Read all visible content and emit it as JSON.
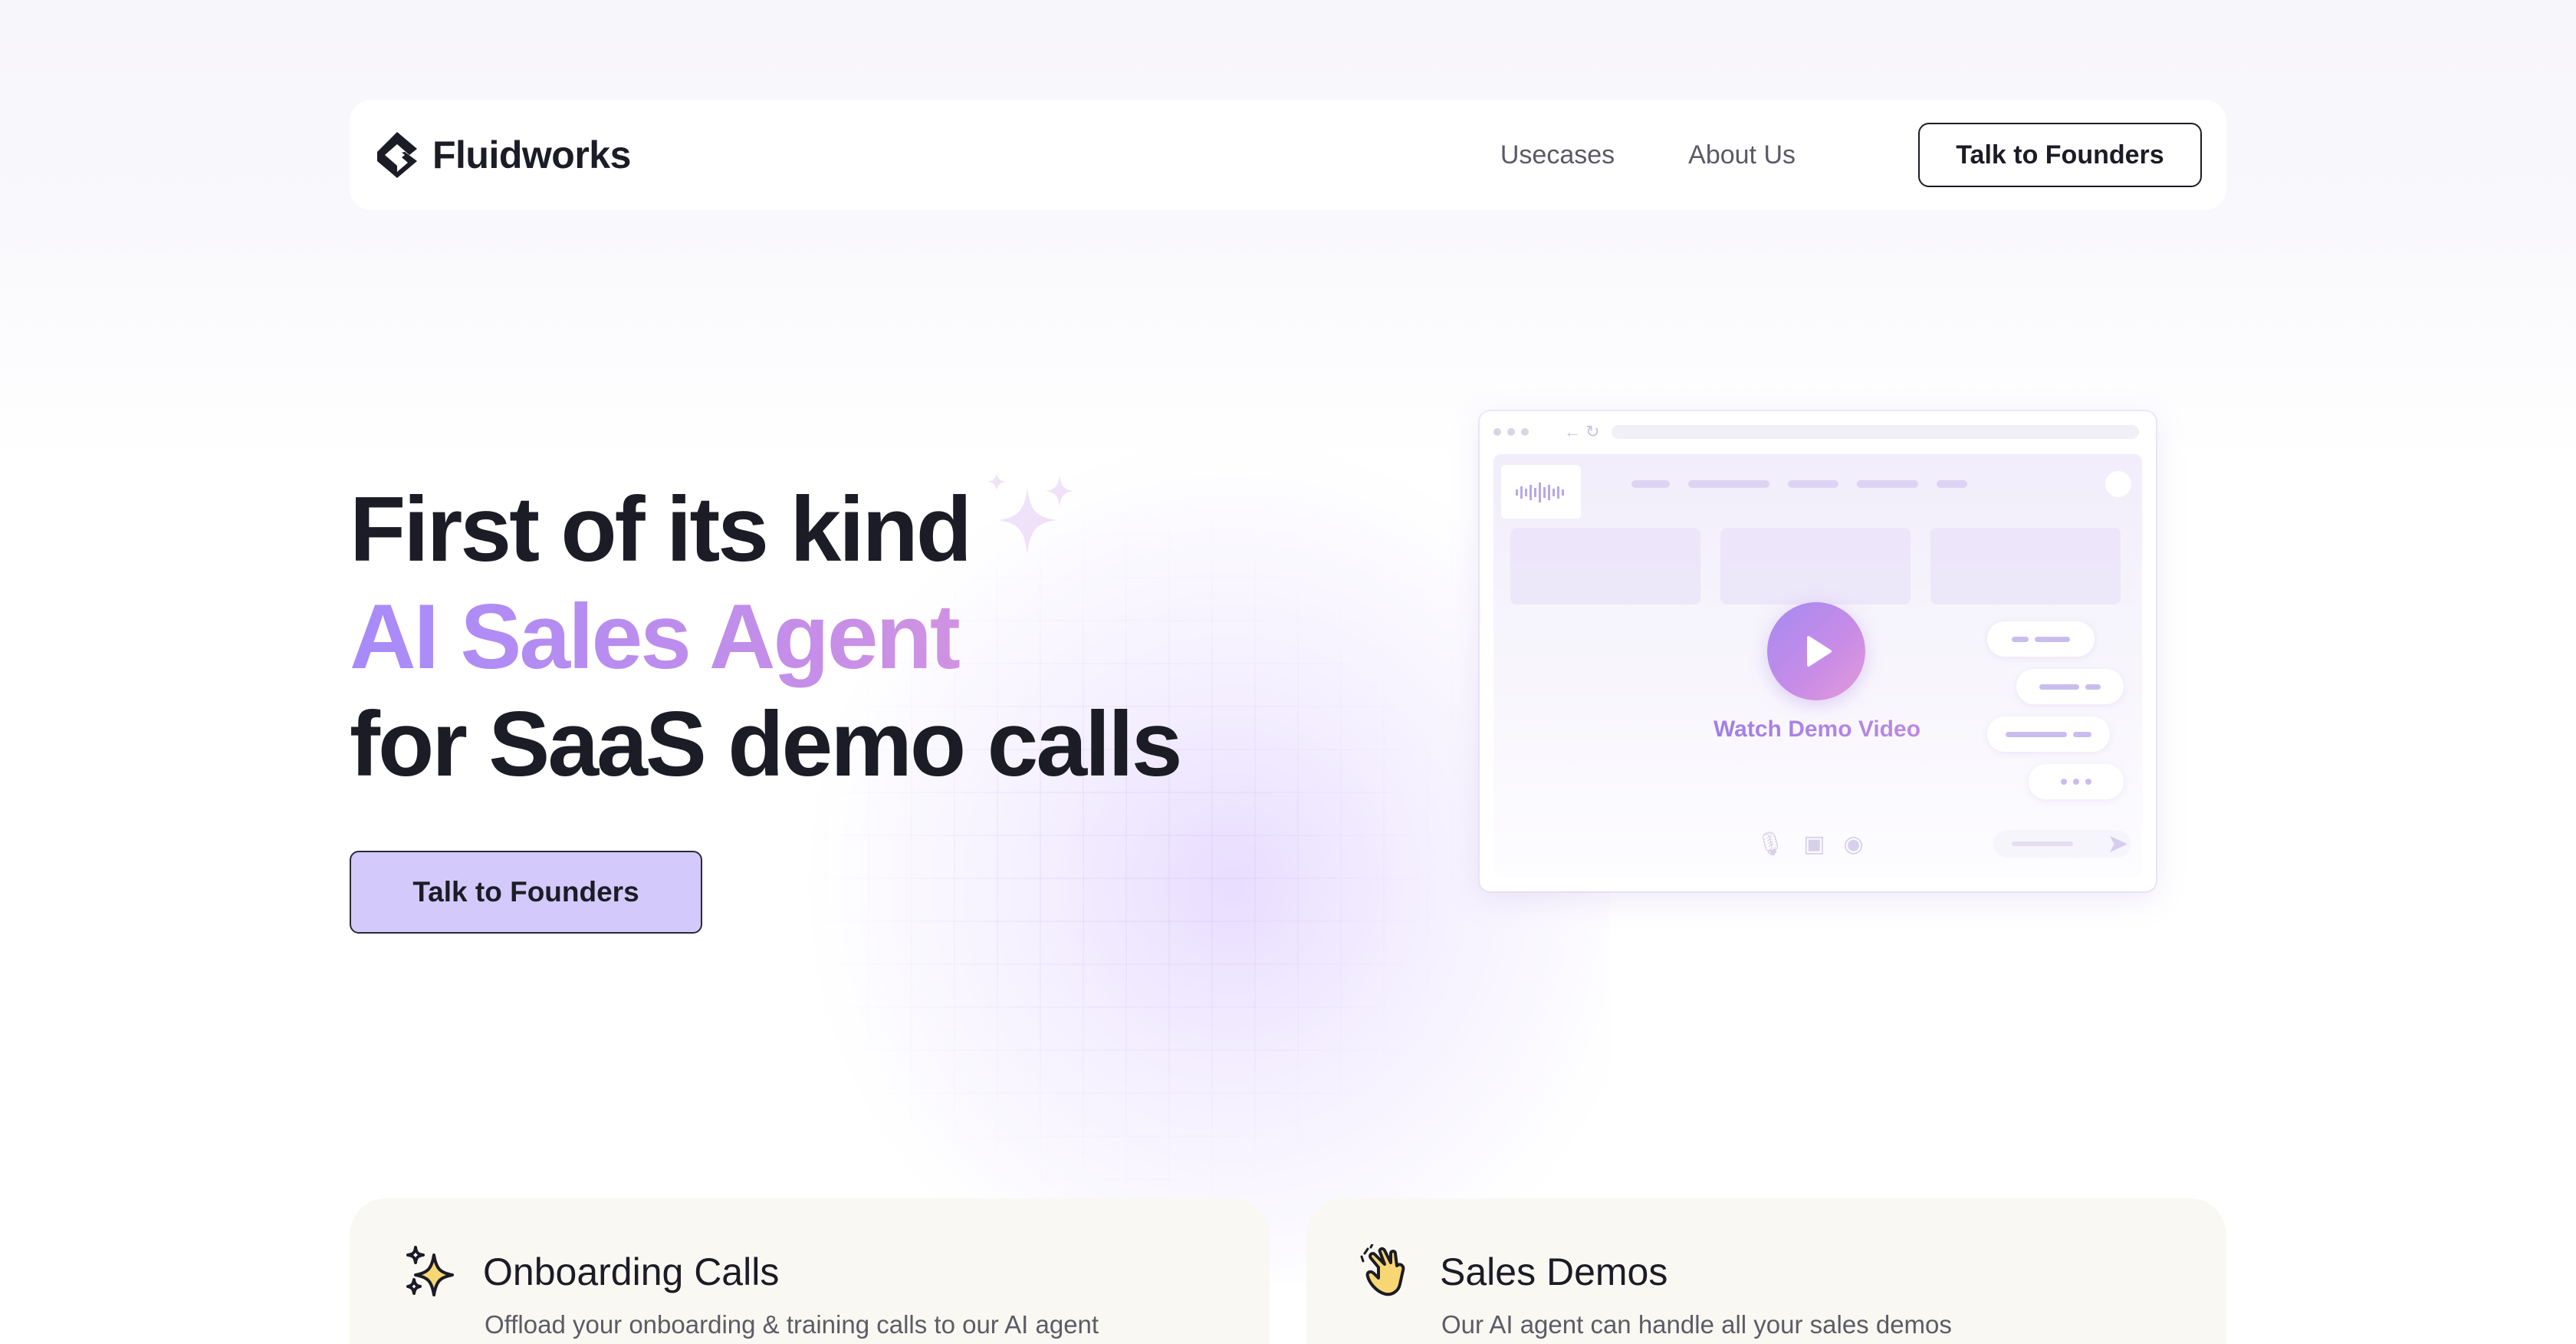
{
  "brand": {
    "name": "Fluidworks"
  },
  "nav": {
    "links": [
      "Usecases",
      "About Us"
    ],
    "cta_label": "Talk to Founders"
  },
  "hero": {
    "line1": "First of its kind",
    "line2": "AI Sales Agent",
    "line3": "for SaaS demo calls",
    "cta_label": "Talk to Founders"
  },
  "demo": {
    "watch_label": "Watch Demo Video"
  },
  "features": [
    {
      "icon": "sparkles-icon",
      "title": "Onboarding Calls",
      "description": "Offload your onboarding & training calls to our AI agent"
    },
    {
      "icon": "pointing-hand-icon",
      "title": "Sales Demos",
      "description": "Our AI agent can handle all your sales demos"
    }
  ],
  "colors": {
    "accent_gradient_start": "#a78bfa",
    "accent_gradient_end": "#df9ad8",
    "hero_cta_bg": "#d3c9fb",
    "text_dark": "#1c1c26",
    "card_bg": "#faf8f2"
  }
}
